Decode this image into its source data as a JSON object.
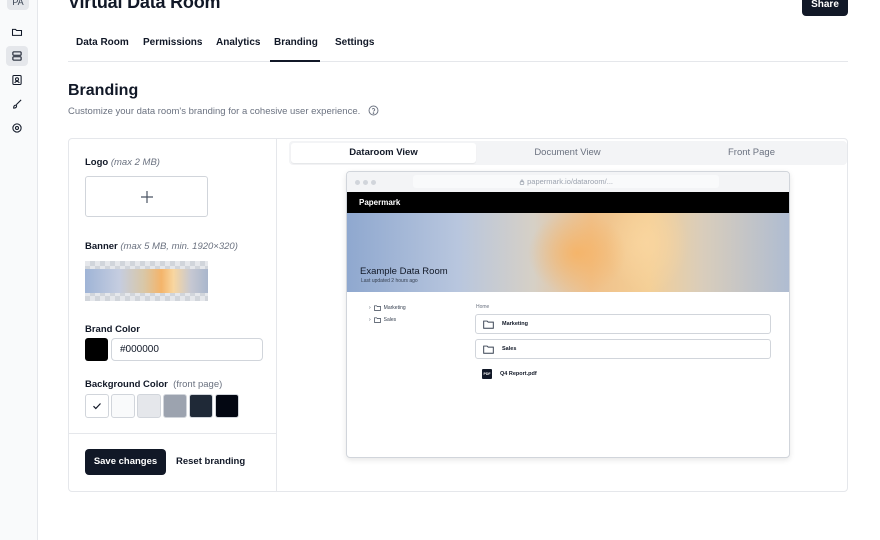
{
  "sidebar": {
    "avatar": "PA",
    "items": [
      {
        "icon": "folder-icon",
        "active": false
      },
      {
        "icon": "server-icon",
        "active": true
      },
      {
        "icon": "contact-icon",
        "active": false
      },
      {
        "icon": "brush-icon",
        "active": false
      },
      {
        "icon": "settings-cog-icon",
        "active": false
      }
    ]
  },
  "header": {
    "title": "Virtual Data Room",
    "share_label": "Share"
  },
  "tabs": [
    {
      "label": "Data Room",
      "active": false
    },
    {
      "label": "Permissions",
      "active": false
    },
    {
      "label": "Analytics",
      "active": false
    },
    {
      "label": "Branding",
      "active": true
    },
    {
      "label": "Settings",
      "active": false
    }
  ],
  "branding": {
    "title": "Branding",
    "subtitle": "Customize your data room's branding for a cohesive user experience.",
    "logo": {
      "label": "Logo",
      "hint": "(max 2 MB)"
    },
    "banner": {
      "label": "Banner",
      "hint": "(max 5 MB, min. 1920×320)"
    },
    "brand_color": {
      "label": "Brand Color",
      "value": "#000000"
    },
    "background_color": {
      "label": "Background Color",
      "hint": "(front page)",
      "swatches": [
        "#ffffff",
        "#f9fafb",
        "#e5e7eb",
        "#9ca3af",
        "#1f2937",
        "#030712"
      ],
      "selected_index": 0
    },
    "save_label": "Save changes",
    "reset_label": "Reset branding"
  },
  "preview": {
    "views": [
      {
        "label": "Dataroom View",
        "active": true
      },
      {
        "label": "Document View",
        "active": false
      },
      {
        "label": "Front Page",
        "active": false
      }
    ],
    "url": "papermark.io/dataroom/...",
    "brand": "Papermark",
    "room_title": "Example Data Room",
    "room_updated": "Last updated 2 hours ago",
    "tree": [
      "Marketing",
      "Sales"
    ],
    "breadcrumb": "Home",
    "rows": [
      {
        "name": "Marketing",
        "type": "folder"
      },
      {
        "name": "Sales",
        "type": "folder"
      },
      {
        "name": "Q4 Report.pdf",
        "type": "pdf",
        "badge": "PDF"
      }
    ]
  }
}
